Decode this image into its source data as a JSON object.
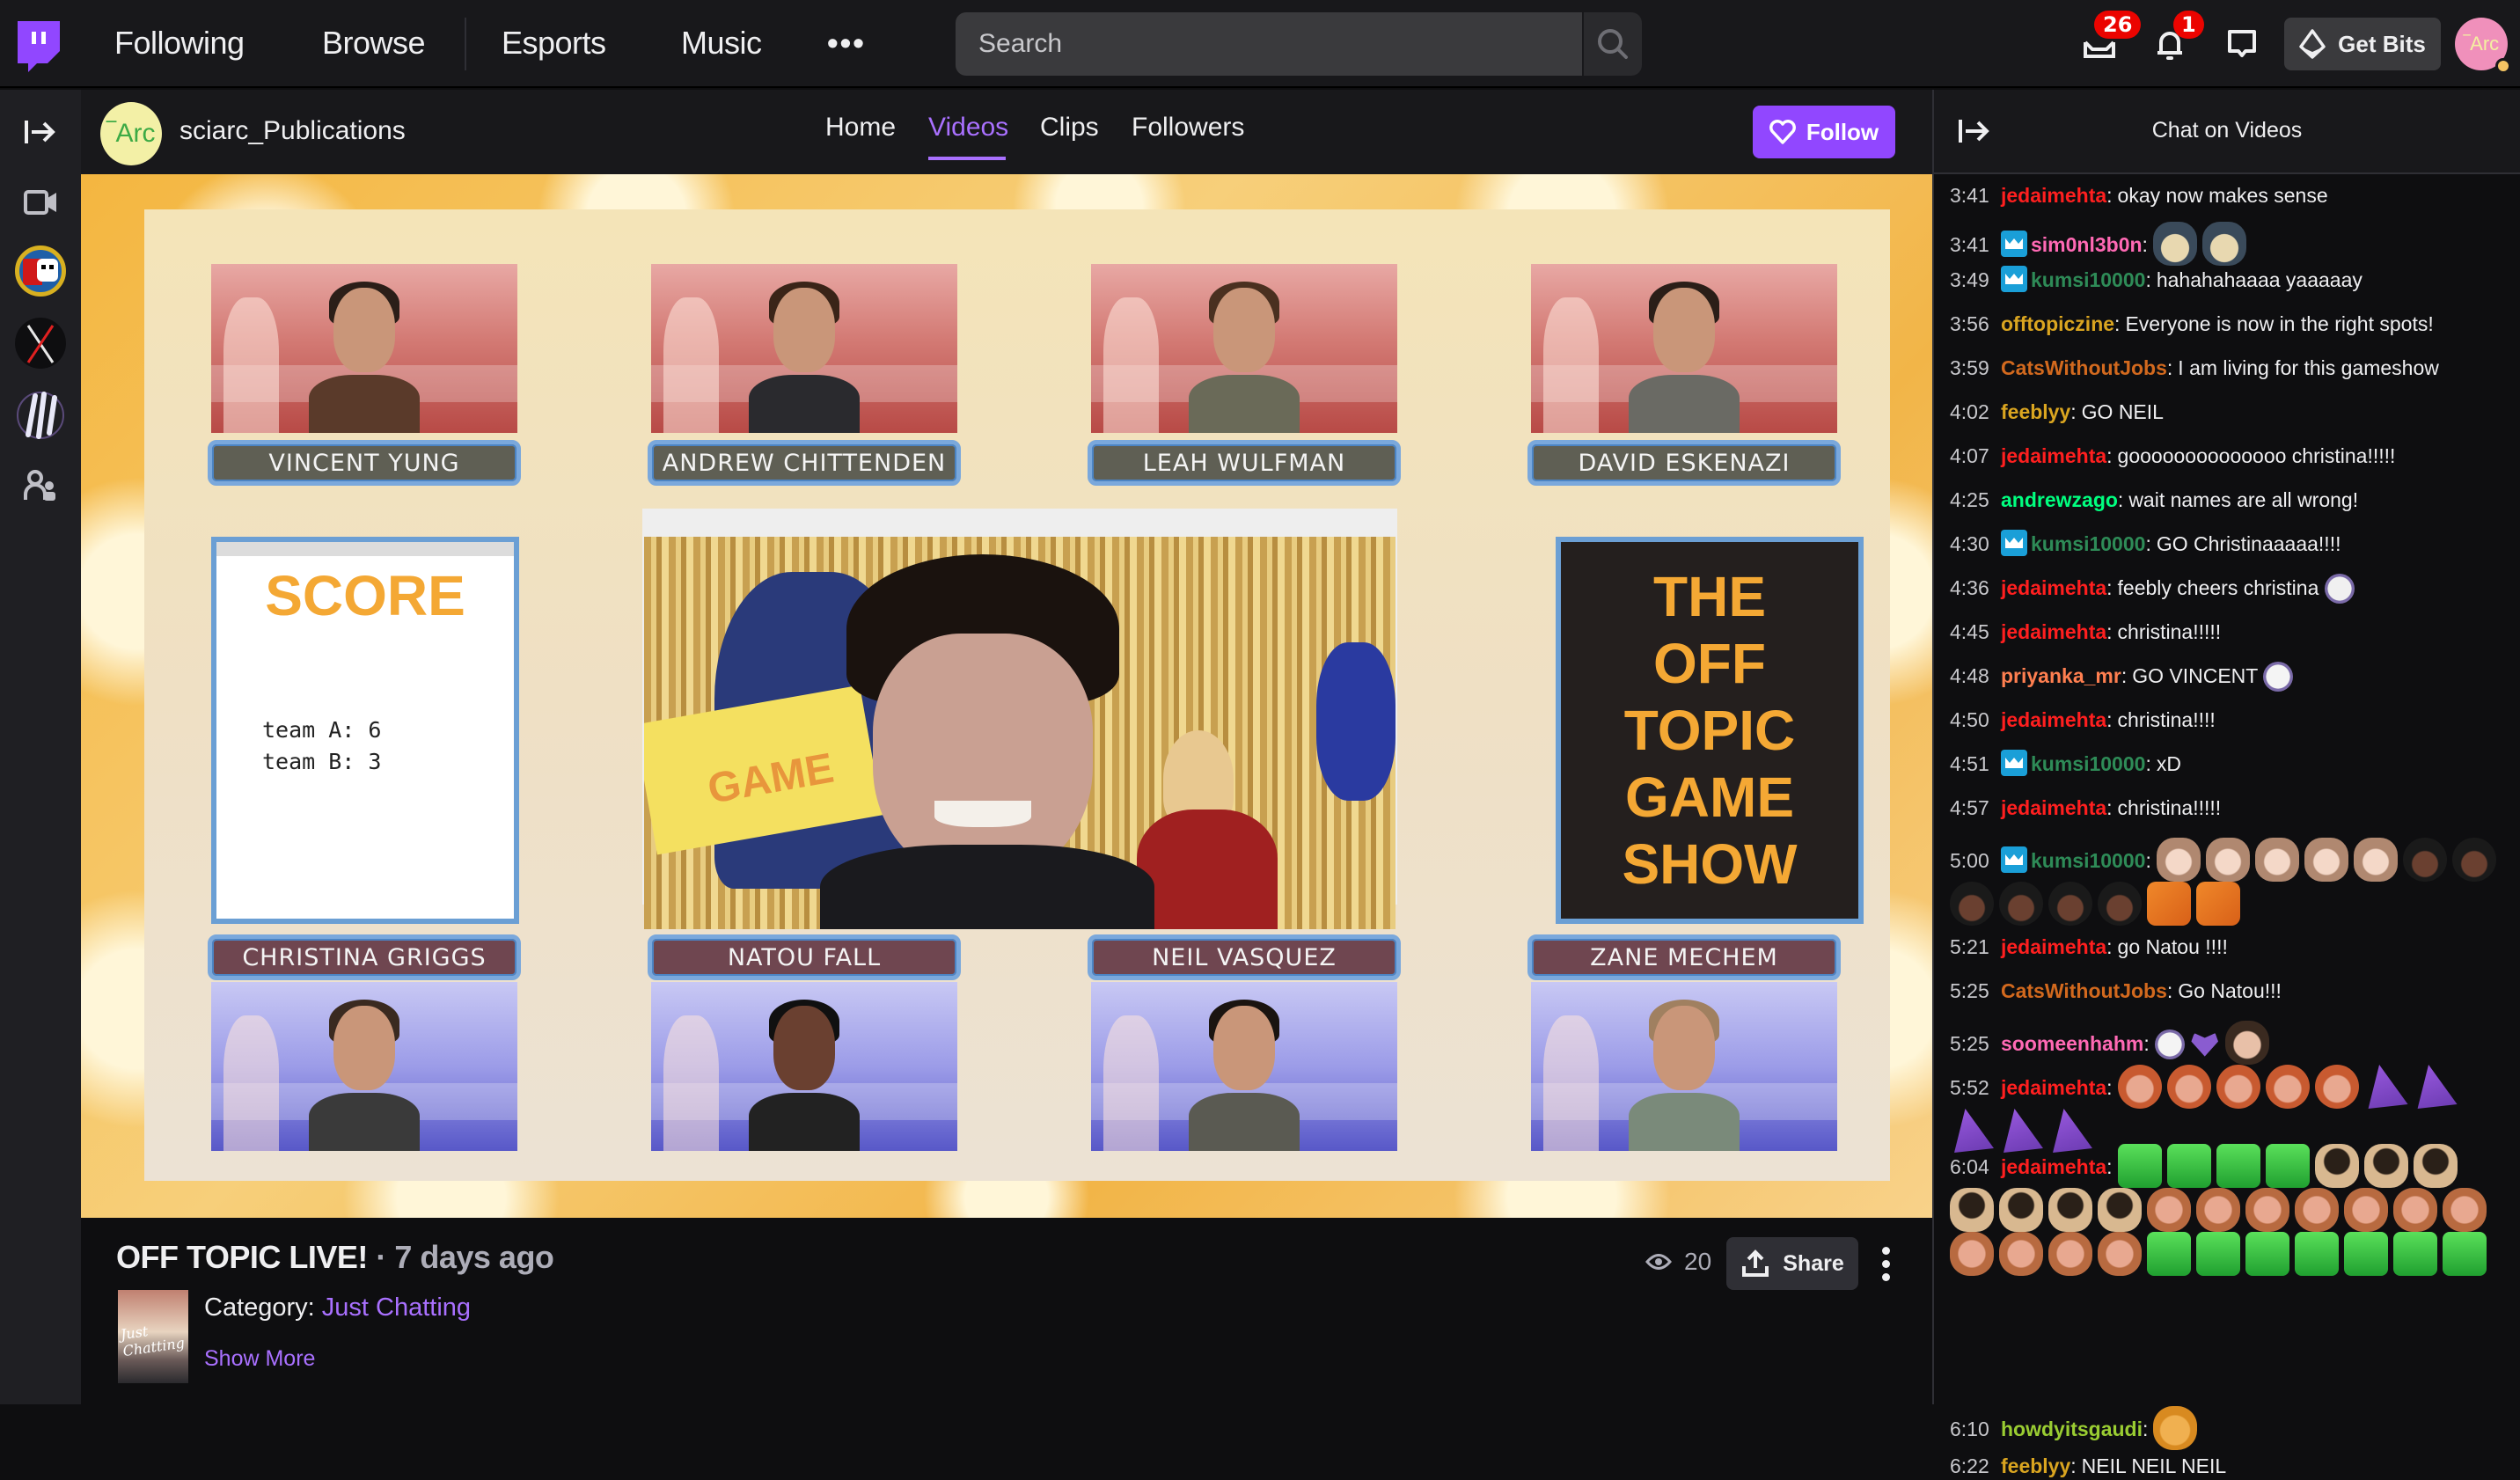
{
  "topnav": {
    "links": [
      "Following",
      "Browse",
      "Esports",
      "Music"
    ],
    "more_label": "•••",
    "search_placeholder": "Search",
    "inbox_badge": "26",
    "notifications_badge": "1",
    "get_bits_label": "Get Bits",
    "user_avatar_text": "‾Arc"
  },
  "leftrail": {
    "items": [
      "collapse-expand",
      "followed-videos",
      "channel-shyguy",
      "channel-swords",
      "channel-claws",
      "friends"
    ]
  },
  "channel": {
    "avatar_text": "‾Arc",
    "name": "sciarc_Publications",
    "tabs": [
      {
        "label": "Home",
        "active": false
      },
      {
        "label": "Videos",
        "active": true
      },
      {
        "label": "Clips",
        "active": false
      },
      {
        "label": "Followers",
        "active": false
      }
    ],
    "follow_label": "Follow"
  },
  "video": {
    "contestants_top": [
      "VINCENT YUNG",
      "ANDREW CHITTENDEN",
      "LEAH WULFMAN",
      "DAVID ESKENAZI"
    ],
    "contestants_bottom": [
      "CHRISTINA GRIGGS",
      "NATOU FALL",
      "NEIL VASQUEZ",
      "ZANE MECHEM"
    ],
    "score_title": "SCORE",
    "score_lines": "team A: 6\nteam B: 3",
    "show_title_lines": [
      "THE",
      "OFF",
      "TOPIC",
      "GAME",
      "SHOW"
    ],
    "main_sign_text": "GAME"
  },
  "video_info": {
    "title": "OFF TOPIC LIVE!",
    "separator": " · ",
    "age": "7 days ago",
    "category_label": "Category: ",
    "category": "Just Chatting",
    "category_thumb_text": "Just Chatting",
    "show_more": "Show More",
    "views": "20",
    "share_label": "Share"
  },
  "chat": {
    "title": "Chat on Videos",
    "colors": {
      "jedaimehta": "#ff1f1f",
      "sim0nl3b0n": "#ff69b4",
      "kumsi10000": "#2e8b57",
      "offtopiczine": "#daa520",
      "CatsWithoutJobs": "#d2691e",
      "feeblyy": "#daa520",
      "andrewzago": "#00ff7f",
      "priyanka_mr": "#ff7f50",
      "soomeenhahm": "#ff69b4",
      "howdyitsgaudi": "#9acd32"
    },
    "messages": [
      {
        "ts": "3:41",
        "user": "jedaimehta",
        "text": "okay now makes sense",
        "sub": false
      },
      {
        "ts": "3:41",
        "user": "sim0nl3b0n",
        "text": "",
        "sub": true,
        "emotes": [
          "cat-shocked",
          "cat-shocked"
        ]
      },
      {
        "ts": "3:49",
        "user": "kumsi10000",
        "text": "hahahahaaaa yaaaaay",
        "sub": true
      },
      {
        "ts": "3:56",
        "user": "offtopiczine",
        "text": "Everyone is now in the right spots!",
        "sub": false
      },
      {
        "ts": "3:59",
        "user": "CatsWithoutJobs",
        "text": "I am living for this gameshow",
        "sub": false
      },
      {
        "ts": "4:02",
        "user": "feeblyy",
        "text": "GO NEIL",
        "sub": false
      },
      {
        "ts": "4:07",
        "user": "jedaimehta",
        "text": "goooooooooooooo christina!!!!!",
        "sub": false
      },
      {
        "ts": "4:25",
        "user": "andrewzago",
        "text": "wait names are all wrong!",
        "sub": false
      },
      {
        "ts": "4:30",
        "user": "kumsi10000",
        "text": "GO Christinaaaaa!!!!",
        "sub": true
      },
      {
        "ts": "4:36",
        "user": "jedaimehta",
        "text": "feebly cheers christina",
        "sub": false,
        "emotes": [
          "crying-face"
        ]
      },
      {
        "ts": "4:45",
        "user": "jedaimehta",
        "text": "christina!!!!!",
        "sub": false
      },
      {
        "ts": "4:48",
        "user": "priyanka_mr",
        "text": "GO VINCENT",
        "sub": false,
        "emotes": [
          "happy-face"
        ]
      },
      {
        "ts": "4:50",
        "user": "jedaimehta",
        "text": "christina!!!!",
        "sub": false
      },
      {
        "ts": "4:51",
        "user": "kumsi10000",
        "text": "xD",
        "sub": true
      },
      {
        "ts": "4:57",
        "user": "jedaimehta",
        "text": "christina!!!!!",
        "sub": false
      },
      {
        "ts": "5:00",
        "user": "kumsi10000",
        "text": "",
        "sub": true,
        "emotes": [
          "angry-girl",
          "angry-girl",
          "angry-girl",
          "angry-girl",
          "angry-girl",
          "crown-guy",
          "crown-guy",
          "crown-guy",
          "crown-guy",
          "crown-guy",
          "crown-guy",
          "charizard",
          "charizard"
        ]
      },
      {
        "ts": "5:21",
        "user": "jedaimehta",
        "text": "go Natou !!!!",
        "sub": false
      },
      {
        "ts": "5:25",
        "user": "CatsWithoutJobs",
        "text": "Go Natou!!!",
        "sub": false
      },
      {
        "ts": "5:25",
        "user": "soomeenhahm",
        "text": "",
        "sub": false,
        "emotes": [
          "ghost-face",
          "purple-heart",
          "laughing-man"
        ]
      },
      {
        "ts": "5:52",
        "user": "jedaimehta",
        "text": "",
        "sub": false,
        "emotes": [
          "sunglasses-guy",
          "sunglasses-guy",
          "sunglasses-guy",
          "sunglasses-guy",
          "sunglasses-guy",
          "party-hat",
          "party-hat",
          "party-hat",
          "party-hat",
          "party-hat"
        ]
      },
      {
        "ts": "6:04",
        "user": "jedaimehta",
        "text": "",
        "sub": false,
        "emotes": [
          "robot",
          "robot",
          "robot",
          "robot",
          "facepalm",
          "facepalm",
          "facepalm",
          "facepalm",
          "facepalm",
          "facepalm",
          "facepalm",
          "thumbs-guy",
          "thumbs-guy",
          "thumbs-guy",
          "thumbs-guy",
          "thumbs-guy",
          "thumbs-guy",
          "thumbs-guy",
          "thumbs-guy",
          "thumbs-guy",
          "thumbs-guy",
          "thumbs-guy",
          "robot",
          "robot",
          "robot",
          "robot",
          "robot",
          "robot",
          "robot"
        ]
      },
      {
        "ts": "6:10",
        "user": "howdyitsgaudi",
        "text": "",
        "sub": false,
        "emotes": [
          "cool-cat"
        ]
      },
      {
        "ts": "6:22",
        "user": "feeblyy",
        "text": "NEIL NEIL NEIL",
        "sub": false
      }
    ]
  }
}
